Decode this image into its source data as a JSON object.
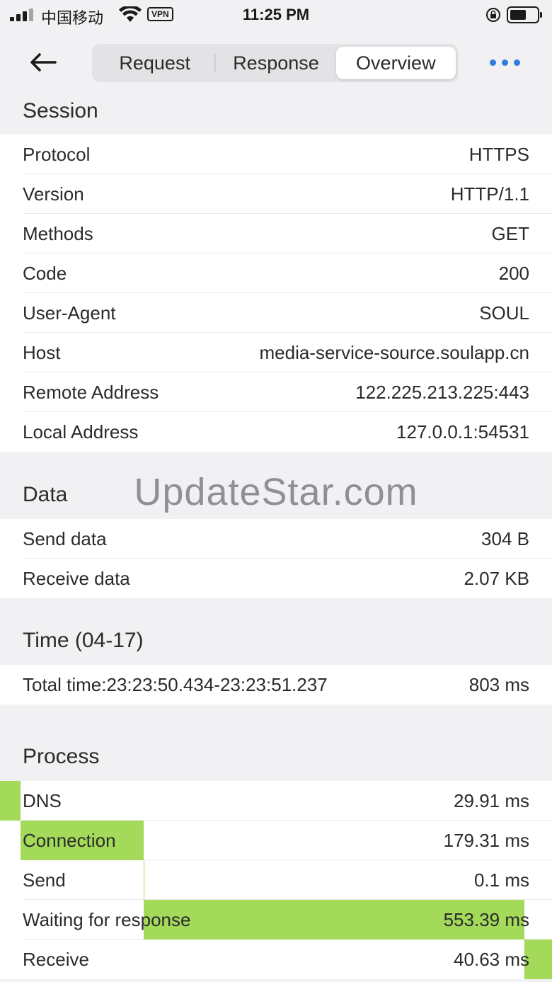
{
  "status": {
    "carrier": "中国移动",
    "vpn": "VPN",
    "time": "11:25 PM"
  },
  "nav": {
    "tabs": [
      "Request",
      "Response",
      "Overview"
    ],
    "active_tab": "Overview"
  },
  "session": {
    "title": "Session",
    "rows": [
      {
        "k": "Protocol",
        "v": "HTTPS"
      },
      {
        "k": "Version",
        "v": "HTTP/1.1"
      },
      {
        "k": "Methods",
        "v": "GET"
      },
      {
        "k": "Code",
        "v": "200"
      },
      {
        "k": "User-Agent",
        "v": "SOUL"
      },
      {
        "k": "Host",
        "v": "media-service-source.soulapp.cn"
      },
      {
        "k": "Remote Address",
        "v": "122.225.213.225:443"
      },
      {
        "k": "Local Address",
        "v": "127.0.0.1:54531"
      }
    ]
  },
  "data_section": {
    "title": "Data",
    "rows": [
      {
        "k": "Send data",
        "v": "304 B"
      },
      {
        "k": "Receive data",
        "v": "2.07 KB"
      }
    ]
  },
  "time_section": {
    "title": "Time (04-17)",
    "rows": [
      {
        "k": "Total time:23:23:50.434-23:23:51.237",
        "v": "803 ms"
      }
    ]
  },
  "process": {
    "title": "Process",
    "total_ms": 803,
    "rows": [
      {
        "k": "DNS",
        "v": "29.91 ms",
        "ms": 29.91
      },
      {
        "k": "Connection",
        "v": "179.31 ms",
        "ms": 179.31
      },
      {
        "k": "Send",
        "v": "0.1 ms",
        "ms": 0.1
      },
      {
        "k": "Waiting for response",
        "v": "553.39 ms",
        "ms": 553.39
      },
      {
        "k": "Receive",
        "v": "40.63 ms",
        "ms": 40.63
      }
    ],
    "bar_color": "#a3da5a"
  },
  "watermark": "UpdateStar.com",
  "colors": {
    "accent": "#2f7de1",
    "background": "#f1f1f3",
    "card": "#ffffff"
  }
}
